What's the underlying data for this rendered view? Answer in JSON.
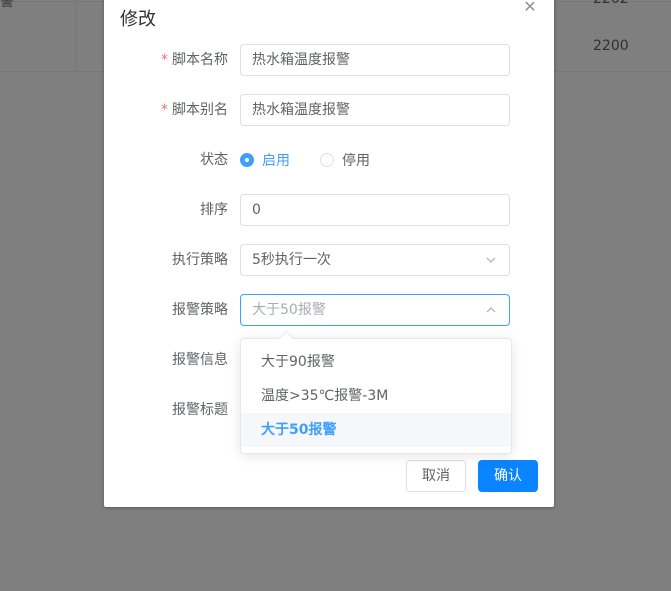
{
  "background_table": {
    "row1_col1": "警",
    "row1_col3": "2202",
    "row2_col3": "2200"
  },
  "dialog": {
    "title": "修改",
    "close_icon": "close-icon"
  },
  "form": {
    "script_name": {
      "label": "脚本名称",
      "required": "*",
      "value": "热水箱温度报警"
    },
    "script_alias": {
      "label": "脚本别名",
      "required": "*",
      "value": "热水箱温度报警"
    },
    "status": {
      "label": "状态",
      "options": [
        {
          "label": "启用",
          "checked": true
        },
        {
          "label": "停用",
          "checked": false
        }
      ]
    },
    "sort": {
      "label": "排序",
      "value": "0"
    },
    "exec_policy": {
      "label": "执行策略",
      "value": "5秒执行一次"
    },
    "alarm_policy": {
      "label": "报警策略",
      "placeholder": "大于50报警"
    },
    "alarm_info": {
      "label": "报警信息"
    },
    "alarm_title": {
      "label": "报警标题"
    }
  },
  "dropdown": {
    "items": [
      {
        "label": "大于90报警",
        "selected": false
      },
      {
        "label": "温度>35℃报警-3M",
        "selected": false
      },
      {
        "label": "大于50报警",
        "selected": true
      }
    ]
  },
  "footer": {
    "cancel_label": "取消",
    "confirm_label": "确认"
  },
  "colors": {
    "primary": "#409eff",
    "confirm_button": "#0a84ff",
    "required": "#f56c6c"
  }
}
